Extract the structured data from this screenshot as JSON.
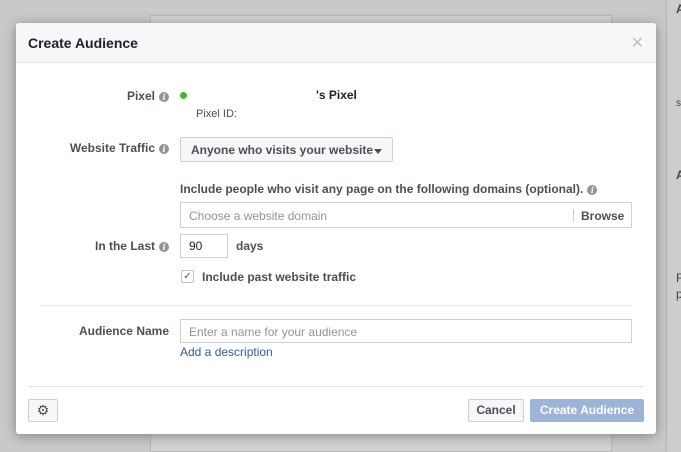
{
  "background": {
    "fragments": [
      "A",
      "s",
      "A",
      "F",
      "p"
    ]
  },
  "dialog": {
    "title": "Create Audience",
    "close_icon": "close-icon",
    "pixel": {
      "label": "Pixel",
      "name": "'s Pixel",
      "id_label": "Pixel ID:",
      "status_color": "#42b72a"
    },
    "website_traffic": {
      "label": "Website Traffic",
      "selected": "Anyone who visits your website"
    },
    "domains": {
      "instruction": "Include people who visit any page on the following domains (optional).",
      "placeholder": "Choose a website domain",
      "browse_label": "Browse"
    },
    "in_the_last": {
      "label": "In the Last",
      "value": "90",
      "unit": "days"
    },
    "include_past": {
      "label": "Include past website traffic",
      "checked": true
    },
    "audience_name": {
      "label": "Audience Name",
      "placeholder": "Enter a name for your audience",
      "add_description": "Add a description"
    },
    "footer": {
      "settings_icon": "gear-icon",
      "cancel_label": "Cancel",
      "create_label": "Create Audience"
    }
  },
  "colors": {
    "link": "#365899",
    "primary_disabled": "#9cb4d8"
  }
}
